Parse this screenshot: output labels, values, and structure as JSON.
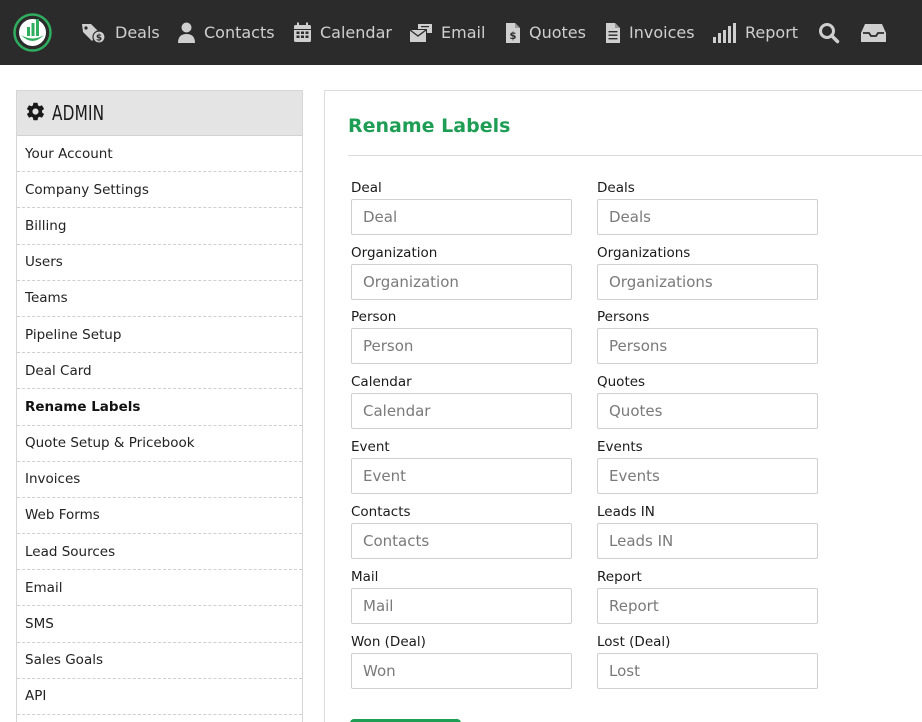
{
  "nav": {
    "items": [
      {
        "label": "Deals",
        "icon": "deals-tag-icon"
      },
      {
        "label": "Contacts",
        "icon": "person-icon"
      },
      {
        "label": "Calendar",
        "icon": "calendar-icon"
      },
      {
        "label": "Email",
        "icon": "email-icon"
      },
      {
        "label": "Quotes",
        "icon": "quote-document-icon"
      },
      {
        "label": "Invoices",
        "icon": "invoice-document-icon"
      },
      {
        "label": "Report",
        "icon": "bar-signal-icon"
      }
    ],
    "search_icon": "search-icon",
    "inbox_icon": "inbox-icon"
  },
  "sidebar": {
    "title": "ADMIN",
    "items": [
      {
        "label": "Your Account"
      },
      {
        "label": "Company Settings"
      },
      {
        "label": "Billing"
      },
      {
        "label": "Users"
      },
      {
        "label": "Teams"
      },
      {
        "label": "Pipeline Setup"
      },
      {
        "label": "Deal Card"
      },
      {
        "label": "Rename Labels",
        "active": true
      },
      {
        "label": "Quote Setup & Pricebook"
      },
      {
        "label": "Invoices"
      },
      {
        "label": "Web Forms"
      },
      {
        "label": "Lead Sources"
      },
      {
        "label": "Email"
      },
      {
        "label": "SMS"
      },
      {
        "label": "Sales Goals"
      },
      {
        "label": "API"
      }
    ]
  },
  "main": {
    "title": "Rename Labels",
    "fields": [
      {
        "label": "Deal",
        "placeholder": "Deal"
      },
      {
        "label": "Deals",
        "placeholder": "Deals"
      },
      {
        "label": "Organization",
        "placeholder": "Organization"
      },
      {
        "label": "Organizations",
        "placeholder": "Organizations"
      },
      {
        "label": "Person",
        "placeholder": "Person"
      },
      {
        "label": "Persons",
        "placeholder": "Persons"
      },
      {
        "label": "Calendar",
        "placeholder": "Calendar"
      },
      {
        "label": "Quotes",
        "placeholder": "Quotes"
      },
      {
        "label": "Event",
        "placeholder": "Event"
      },
      {
        "label": "Events",
        "placeholder": "Events"
      },
      {
        "label": "Contacts",
        "placeholder": "Contacts"
      },
      {
        "label": "Leads IN",
        "placeholder": "Leads IN"
      },
      {
        "label": "Mail",
        "placeholder": "Mail"
      },
      {
        "label": "Report",
        "placeholder": "Report"
      },
      {
        "label": "Won (Deal)",
        "placeholder": "Won"
      },
      {
        "label": "Lost (Deal)",
        "placeholder": "Lost"
      }
    ]
  },
  "colors": {
    "accent": "#1e9e55",
    "nav_bg": "#2b2b2b",
    "nav_text": "#cfcfcf"
  }
}
